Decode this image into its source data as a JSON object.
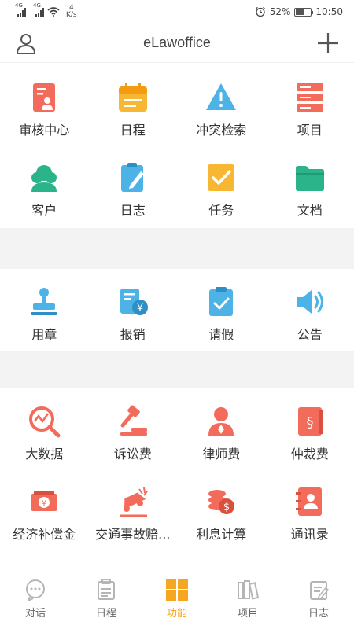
{
  "status_bar": {
    "signal1": "4G",
    "signal2": "4G",
    "net_speed_value": "4",
    "net_speed_unit": "K/s",
    "battery_percent": "52%",
    "battery_level": 0.52,
    "time": "10:50"
  },
  "header": {
    "title": "eLawoffice",
    "icons": {
      "left": "user-icon",
      "right": "plus-icon"
    }
  },
  "sections": {
    "main": [
      {
        "label": "审核中心",
        "icon": "review-icon",
        "color": "#f26b5b"
      },
      {
        "label": "日程",
        "icon": "calendar-icon",
        "color": "#f7b733"
      },
      {
        "label": "冲突检索",
        "icon": "warning-icon",
        "color": "#4db3e6"
      },
      {
        "label": "项目",
        "icon": "server-icon",
        "color": "#f26b5b"
      },
      {
        "label": "客户",
        "icon": "client-icon",
        "color": "#2bb38a"
      },
      {
        "label": "日志",
        "icon": "clipboard-pen-icon",
        "color": "#4db3e6"
      },
      {
        "label": "任务",
        "icon": "checkbox-icon",
        "color": "#f7b733"
      },
      {
        "label": "文档",
        "icon": "folder-icon",
        "color": "#2bb38a"
      }
    ],
    "admin": [
      {
        "label": "用章",
        "icon": "stamp-icon",
        "color": "#4db3e6"
      },
      {
        "label": "报销",
        "icon": "reimburse-icon",
        "color": "#4db3e6"
      },
      {
        "label": "请假",
        "icon": "leave-icon",
        "color": "#4db3e6"
      },
      {
        "label": "公告",
        "icon": "speaker-icon",
        "color": "#4db3e6"
      }
    ],
    "tools": [
      {
        "label": "大数据",
        "icon": "chart-search-icon",
        "color": "#f26b5b"
      },
      {
        "label": "诉讼费",
        "icon": "gavel-icon",
        "color": "#f26b5b"
      },
      {
        "label": "律师费",
        "icon": "lawyer-icon",
        "color": "#f26b5b"
      },
      {
        "label": "仲裁费",
        "icon": "law-book-icon",
        "color": "#f26b5b"
      },
      {
        "label": "经济补偿金",
        "icon": "money-icon",
        "color": "#f26b5b"
      },
      {
        "label": "交通事故赔...",
        "icon": "car-accident-icon",
        "color": "#f26b5b"
      },
      {
        "label": "利息计算",
        "icon": "coins-icon",
        "color": "#f26b5b"
      },
      {
        "label": "通讯录",
        "icon": "contacts-icon",
        "color": "#f26b5b"
      }
    ]
  },
  "tabbar": [
    {
      "label": "对话",
      "icon": "chat-icon",
      "active": false
    },
    {
      "label": "日程",
      "icon": "schedule-icon",
      "active": false
    },
    {
      "label": "功能",
      "icon": "grid-icon",
      "active": true
    },
    {
      "label": "项目",
      "icon": "books-icon",
      "active": false
    },
    {
      "label": "日志",
      "icon": "log-icon",
      "active": false
    }
  ],
  "colors": {
    "accent": "#f5a623",
    "divider": "#f3f3f3"
  }
}
